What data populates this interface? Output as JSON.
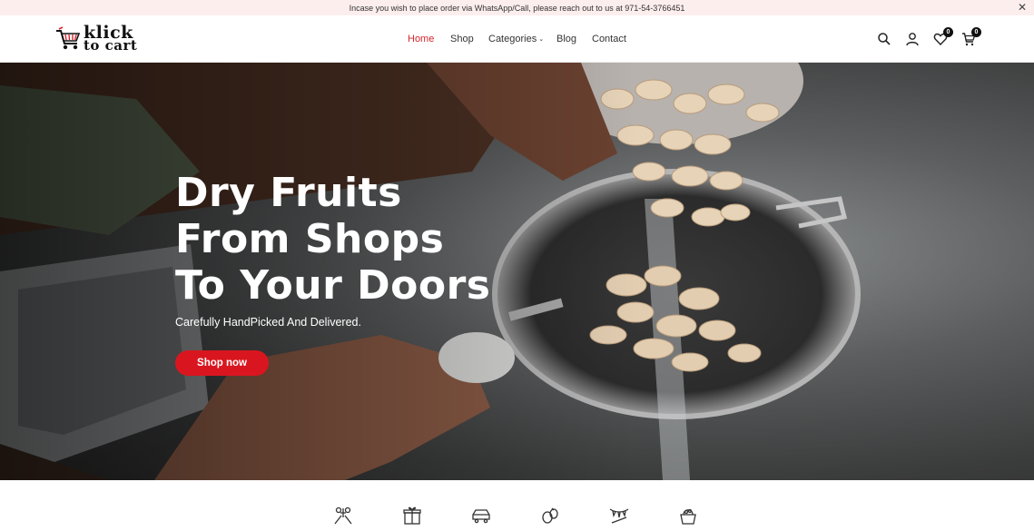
{
  "announcement": {
    "text": "Incase you wish to place order via WhatsApp/Call, please reach out to us at 971-54-3766451",
    "close_icon": "close-icon"
  },
  "brand": {
    "line1": "klick",
    "line2": "to cart",
    "logo_icon": "shopping-cart-icon",
    "accent_color": "#d9252e"
  },
  "nav": {
    "items": [
      {
        "label": "Home",
        "active": true
      },
      {
        "label": "Shop"
      },
      {
        "label": "Categories",
        "caret": "⌄"
      },
      {
        "label": "Blog"
      },
      {
        "label": "Contact"
      }
    ]
  },
  "actions": {
    "search_icon": "search-icon",
    "account_icon": "user-icon",
    "wishlist_icon": "heart-icon",
    "wishlist_count": "0",
    "cart_icon": "cart-icon",
    "cart_count": "0"
  },
  "hero": {
    "title_lines": [
      "Dry Fruits",
      "From Shops",
      "To Your Doors"
    ],
    "subtitle": "Carefully HandPicked And Delivered.",
    "cta_label": "Shop now",
    "cta_color": "#d9161f"
  },
  "categories": {
    "icons": [
      "gifting-icon",
      "gift-box-icon",
      "car-icon",
      "nuts-icon",
      "celebration-icon",
      "hamper-icon"
    ]
  }
}
